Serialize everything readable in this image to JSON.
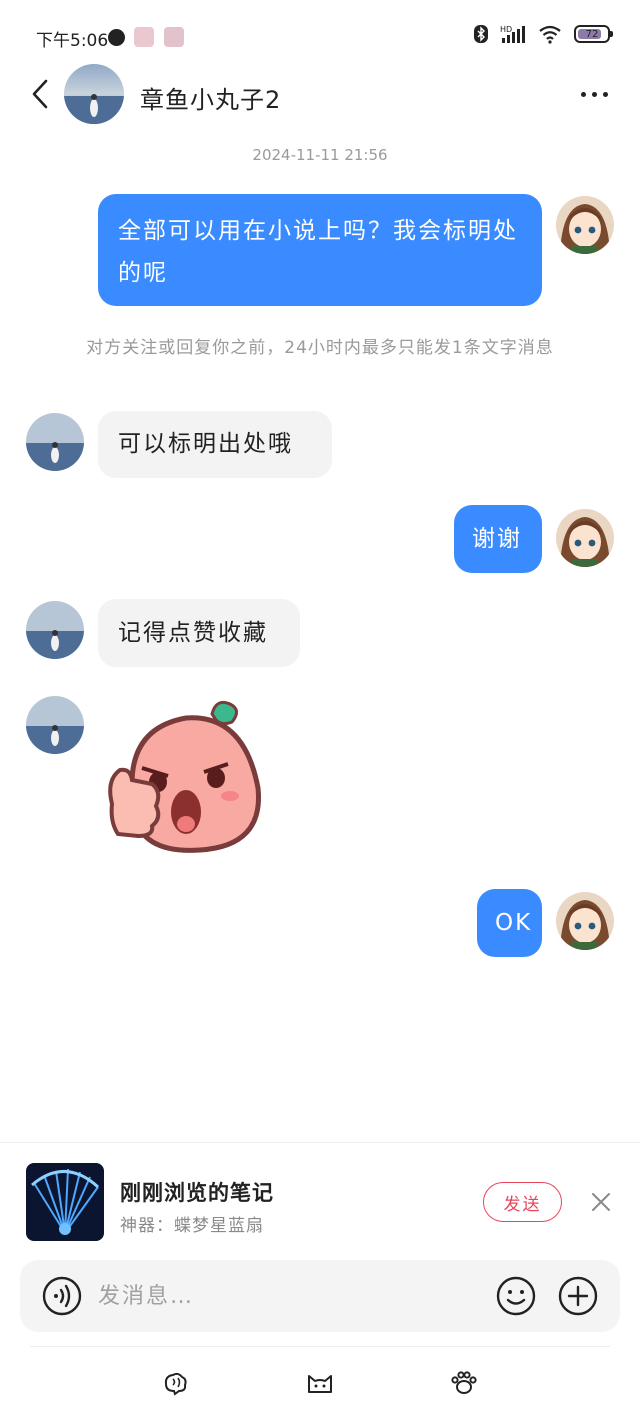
{
  "status_bar": {
    "time": "下午5:06",
    "battery": "72",
    "icons": [
      "wechat-like-icon",
      "app-icon-1",
      "app-icon-2",
      "bluetooth-icon",
      "hd-signal-icon",
      "wifi-icon",
      "battery-icon"
    ]
  },
  "header": {
    "name": "章鱼小丸子2",
    "back_icon": "chevron-left-icon",
    "more_icon": "more-dots-icon"
  },
  "chat": {
    "timestamp": "2024-11-11 21:56",
    "messages": [
      {
        "from": "me",
        "text": "全部可以用在小说上吗？我会标明处的呢"
      },
      {
        "from": "system",
        "text": "对方关注或回复你之前，24小时内最多只能发1条文字消息"
      },
      {
        "from": "them",
        "text": "可以标明出处哦"
      },
      {
        "from": "me",
        "text": "谢谢"
      },
      {
        "from": "them",
        "text": "记得点赞收藏"
      },
      {
        "from": "them",
        "type": "sticker",
        "sticker": "angry-thumbs-up-sticker"
      },
      {
        "from": "me",
        "text": "OK"
      }
    ]
  },
  "note_panel": {
    "title": "刚刚浏览的笔记",
    "subtitle": "神器：蝶梦星蓝扇",
    "send_label": "发送"
  },
  "input_bar": {
    "placeholder": "发消息…"
  },
  "colors": {
    "outgoing_bubble": "#3a8bff",
    "incoming_bubble": "#f3f3f3",
    "send_accent": "#e8455a"
  }
}
